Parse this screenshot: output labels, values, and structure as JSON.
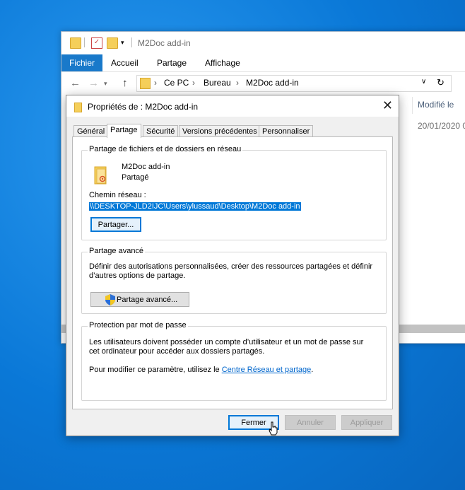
{
  "explorer": {
    "title": "M2Doc add-in",
    "ribbon_tabs": [
      "Fichier",
      "Accueil",
      "Partage",
      "Affichage"
    ],
    "breadcrumb": [
      "Ce PC",
      "Bureau",
      "M2Doc add-in"
    ],
    "column_modified": "Modifié le",
    "first_row_date": "20/01/2020 0"
  },
  "dialog": {
    "title": "Propriétés de : M2Doc add-in",
    "tabs": [
      "Général",
      "Partage",
      "Sécurité",
      "Versions précédentes",
      "Personnaliser"
    ],
    "active_tab": "Partage",
    "network_group": {
      "legend": "Partage de fichiers et de dossiers en réseau",
      "folder_name": "M2Doc add-in",
      "folder_state": "Partagé",
      "path_label": "Chemin réseau :",
      "path_value": "\\\\DESKTOP-JLD2IJC\\Users\\ylussaud\\Desktop\\M2Doc add-in",
      "share_button": "Partager..."
    },
    "advanced_group": {
      "legend": "Partage avancé",
      "line1": "Définir des autorisations personnalisées, créer des ressources partagées et définir",
      "line2": "d’autres options de partage.",
      "button": "Partage avancé..."
    },
    "password_group": {
      "legend": "Protection par mot de passe",
      "line1": "Les utilisateurs doivent posséder un compte d’utilisateur et un mot de passe sur",
      "line2": "cet ordinateur pour accéder aux dossiers partagés.",
      "line3_prefix": "Pour modifier ce paramètre, utilisez le ",
      "link": "Centre Réseau et partage",
      "line3_suffix": "."
    },
    "buttons": {
      "close": "Fermer",
      "cancel": "Annuler",
      "apply": "Appliquer"
    }
  },
  "colors": {
    "desktop": "#0a78d7",
    "accent": "#0078d7",
    "file_tab": "#1979ca"
  }
}
